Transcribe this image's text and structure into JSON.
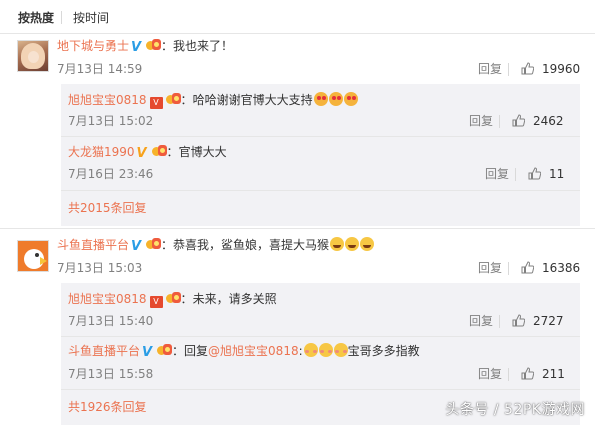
{
  "sort": {
    "hot": "按热度",
    "time": "按时间"
  },
  "reply_label": "回复",
  "threads": [
    {
      "user": "地下城与勇士",
      "text": "我也来了！",
      "time": "7月13日 14:59",
      "likes": "19960",
      "replies": [
        {
          "user": "旭旭宝宝0818",
          "text": "哈哈谢谢官博大大支持",
          "time": "7月13日 15:02",
          "likes": "2462"
        },
        {
          "user": "大龙猫1990",
          "text": "官博大大",
          "time": "7月16日 23:46",
          "likes": "11"
        }
      ],
      "more": "共2015条回复"
    },
    {
      "user": "斗鱼直播平台",
      "text": "恭喜我，鲨鱼娘，喜提大马猴",
      "time": "7月13日 15:03",
      "likes": "16386",
      "replies": [
        {
          "user": "旭旭宝宝0818",
          "text": "未来，请多关照",
          "time": "7月13日 15:40",
          "likes": "2727"
        },
        {
          "user": "斗鱼直播平台",
          "text_prefix": "回复",
          "mention": "@旭旭宝宝0818",
          "text_suffix": "宝哥多多指教",
          "time": "7月13日 15:58",
          "likes": "211"
        }
      ],
      "more": "共1926条回复"
    }
  ],
  "watermark": "头条号 / 52PK游戏网",
  "icons": {
    "verified": "verified-v-icon",
    "vip": "vip-badge-icon",
    "fan": "fan-badge-icon",
    "like": "thumb-up-icon"
  },
  "colors": {
    "username": "#eb7350",
    "verified": "#2a9de5",
    "reply_bg": "#f2f2f5",
    "meta": "#808080"
  }
}
